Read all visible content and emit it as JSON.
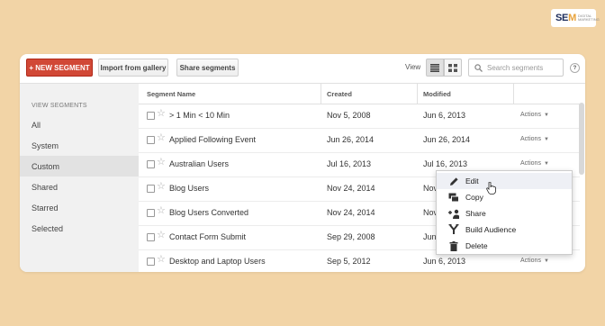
{
  "brand": {
    "logo_text": "SEM",
    "logo_tagline": "DIGITAL MARKETING"
  },
  "toolbar": {
    "new_segment_label": "+ NEW SEGMENT",
    "import_label": "Import from gallery",
    "share_label": "Share segments",
    "view_label": "View",
    "search_placeholder": "Search segments",
    "help_label": "?"
  },
  "sidebar": {
    "heading": "VIEW SEGMENTS",
    "items": [
      {
        "label": "All"
      },
      {
        "label": "System"
      },
      {
        "label": "Custom",
        "active": true
      },
      {
        "label": "Shared"
      },
      {
        "label": "Starred"
      },
      {
        "label": "Selected"
      }
    ]
  },
  "table": {
    "headers": {
      "name": "Segment Name",
      "created": "Created",
      "modified": "Modified"
    },
    "actions_label": "Actions",
    "rows": [
      {
        "name": "> 1 Min < 10 Min",
        "created": "Nov 5, 2008",
        "modified": "Jun 6, 2013"
      },
      {
        "name": "Applied Following Event",
        "created": "Jun 26, 2014",
        "modified": "Jun 26, 2014"
      },
      {
        "name": "Australian Users",
        "created": "Jul 16, 2013",
        "modified": "Jul 16, 2013"
      },
      {
        "name": "Blog Users",
        "created": "Nov 24, 2014",
        "modified": "Nov"
      },
      {
        "name": "Blog Users Converted",
        "created": "Nov 24, 2014",
        "modified": "Nov"
      },
      {
        "name": "Contact Form Submit",
        "created": "Sep 29, 2008",
        "modified": "Jun"
      },
      {
        "name": "Desktop and Laptop Users",
        "created": "Sep 5, 2012",
        "modified": "Jun 6, 2013"
      }
    ]
  },
  "context_menu": {
    "items": [
      {
        "label": "Edit",
        "icon": "pencil-icon"
      },
      {
        "label": "Copy",
        "icon": "copy-icon"
      },
      {
        "label": "Share",
        "icon": "share-user-icon"
      },
      {
        "label": "Build Audience",
        "icon": "fork-icon"
      },
      {
        "label": "Delete",
        "icon": "trash-icon"
      }
    ]
  },
  "colors": {
    "background": "#f2d4a6",
    "primary_button": "#d14836"
  }
}
